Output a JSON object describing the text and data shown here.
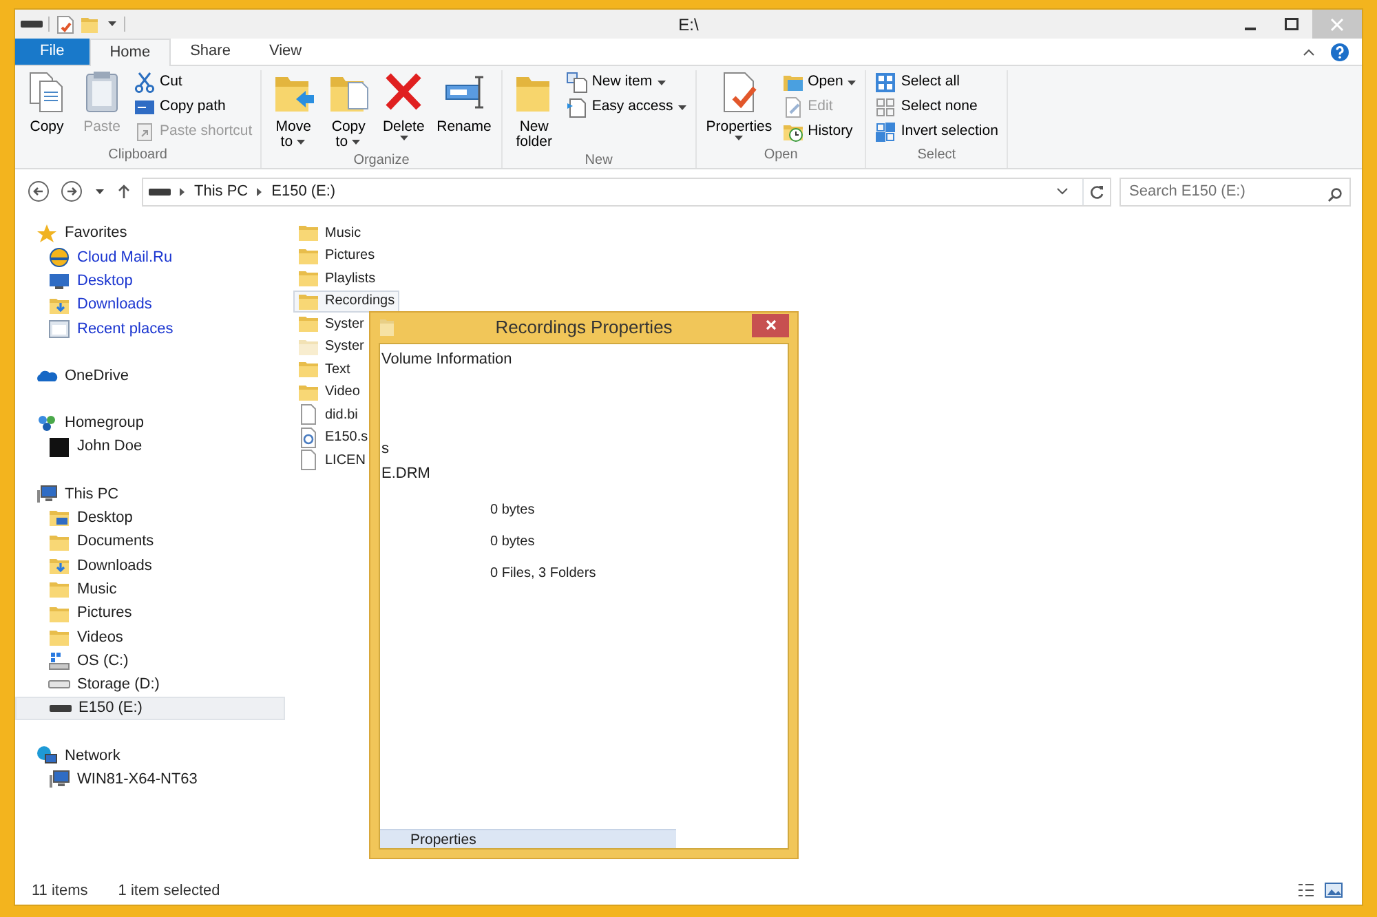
{
  "window": {
    "title": "E:\\"
  },
  "ribbon": {
    "tabs": [
      {
        "label": "File",
        "kind": "file",
        "selected": false
      },
      {
        "label": "Home",
        "kind": "tab",
        "selected": true
      },
      {
        "label": "Share",
        "kind": "tab",
        "selected": false
      },
      {
        "label": "View",
        "kind": "tab",
        "selected": false
      }
    ],
    "groups": [
      {
        "label": "Clipboard",
        "commands": [
          {
            "lines": [
              "Copy"
            ],
            "kind": "large",
            "disabled": false,
            "dropdown": false
          },
          {
            "lines": [
              "Paste"
            ],
            "kind": "large",
            "disabled": true,
            "dropdown": false
          },
          {
            "lines": [
              "Cut"
            ],
            "kind": "small",
            "disabled": false,
            "dropdown": false
          },
          {
            "lines": [
              "Copy path"
            ],
            "kind": "small",
            "disabled": false,
            "dropdown": false
          },
          {
            "lines": [
              "Paste shortcut"
            ],
            "kind": "small",
            "disabled": true,
            "dropdown": false
          }
        ]
      },
      {
        "label": "Organize",
        "commands": [
          {
            "lines": [
              "Move",
              "to"
            ],
            "kind": "large",
            "disabled": false,
            "dropdown": true
          },
          {
            "lines": [
              "Copy",
              "to"
            ],
            "kind": "large",
            "disabled": false,
            "dropdown": true
          },
          {
            "lines": [
              "Delete"
            ],
            "kind": "large",
            "disabled": false,
            "dropdown": true
          },
          {
            "lines": [
              "Rename"
            ],
            "kind": "large",
            "disabled": false,
            "dropdown": false
          }
        ]
      },
      {
        "label": "New",
        "commands": [
          {
            "lines": [
              "New",
              "folder"
            ],
            "kind": "large",
            "disabled": false,
            "dropdown": false
          },
          {
            "lines": [
              "New item"
            ],
            "kind": "small",
            "disabled": false,
            "dropdown": true
          },
          {
            "lines": [
              "Easy access"
            ],
            "kind": "small",
            "disabled": false,
            "dropdown": true
          }
        ]
      },
      {
        "label": "Open",
        "commands": [
          {
            "lines": [
              "Properties"
            ],
            "kind": "large",
            "disabled": false,
            "dropdown": true
          },
          {
            "lines": [
              "Open"
            ],
            "kind": "small",
            "disabled": false,
            "dropdown": true
          },
          {
            "lines": [
              "Edit"
            ],
            "kind": "small",
            "disabled": true,
            "dropdown": false
          },
          {
            "lines": [
              "History"
            ],
            "kind": "small",
            "disabled": false,
            "dropdown": false
          }
        ]
      },
      {
        "label": "Select",
        "commands": [
          {
            "lines": [
              "Select all"
            ],
            "kind": "small",
            "disabled": false,
            "dropdown": false
          },
          {
            "lines": [
              "Select none"
            ],
            "kind": "small",
            "disabled": false,
            "dropdown": false
          },
          {
            "lines": [
              "Invert selection"
            ],
            "kind": "small",
            "disabled": false,
            "dropdown": false
          }
        ]
      }
    ]
  },
  "address": {
    "crumbs": [
      "This PC",
      "E150 (E:)"
    ],
    "search_placeholder": "Search E150 (E:)"
  },
  "navigation": [
    {
      "label": "Favorites",
      "kind": "star",
      "children": [
        {
          "label": "Cloud Mail.Ru",
          "kind": "cloud",
          "link": true,
          "selected": false
        },
        {
          "label": "Desktop",
          "kind": "desktop",
          "link": true,
          "selected": false
        },
        {
          "label": "Downloads",
          "kind": "downloads",
          "link": true,
          "selected": false
        },
        {
          "label": "Recent places",
          "kind": "recent",
          "link": true,
          "selected": false
        }
      ]
    },
    {
      "label": "OneDrive",
      "kind": "onedrive"
    },
    {
      "label": "Homegroup",
      "kind": "homegroup",
      "children": [
        {
          "label": "John Doe",
          "kind": "user",
          "link": false,
          "selected": false
        }
      ]
    },
    {
      "label": "This PC",
      "kind": "computer",
      "children": [
        {
          "label": "Desktop",
          "kind": "desktop-folder",
          "link": false,
          "selected": false
        },
        {
          "label": "Documents",
          "kind": "folder",
          "link": false,
          "selected": false
        },
        {
          "label": "Downloads",
          "kind": "downloads",
          "link": false,
          "selected": false
        },
        {
          "label": "Music",
          "kind": "folder",
          "link": false,
          "selected": false
        },
        {
          "label": "Pictures",
          "kind": "folder",
          "link": false,
          "selected": false
        },
        {
          "label": "Videos",
          "kind": "folder",
          "link": false,
          "selected": false
        },
        {
          "label": "OS (C:)",
          "kind": "os-drive",
          "link": false,
          "selected": false
        },
        {
          "label": "Storage (D:)",
          "kind": "hdd",
          "link": false,
          "selected": false
        },
        {
          "label": "E150 (E:)",
          "kind": "drive",
          "link": false,
          "selected": true
        }
      ]
    },
    {
      "label": "Network",
      "kind": "network",
      "children": [
        {
          "label": "WIN81-X64-NT63",
          "kind": "computer",
          "link": false,
          "selected": false
        }
      ]
    }
  ],
  "files": [
    {
      "name": "Music",
      "kind": "folder",
      "selected": false
    },
    {
      "name": "Pictures",
      "kind": "folder",
      "selected": false
    },
    {
      "name": "Playlists",
      "kind": "folder",
      "selected": false
    },
    {
      "name": "Recordings",
      "kind": "folder",
      "selected": true
    },
    {
      "name": "Syster",
      "kind": "folder",
      "selected": false
    },
    {
      "name": "Syster",
      "kind": "hidden-folder",
      "selected": false
    },
    {
      "name": "Text",
      "kind": "folder",
      "selected": false
    },
    {
      "name": "Video",
      "kind": "folder",
      "selected": false
    },
    {
      "name": "did.bi",
      "kind": "file",
      "selected": false
    },
    {
      "name": "E150.s",
      "kind": "system-file",
      "selected": false
    },
    {
      "name": "LICEN",
      "kind": "file",
      "selected": false
    }
  ],
  "status_bar": {
    "item_count": "11 items",
    "selection": "1 item selected"
  },
  "dialog": {
    "title": "Recordings Properties",
    "bleed_texts": [
      "Volume Information",
      "s",
      "E.DRM"
    ],
    "values": [
      "0 bytes",
      "0 bytes",
      "0 Files, 3 Folders"
    ],
    "tab": "Properties"
  }
}
